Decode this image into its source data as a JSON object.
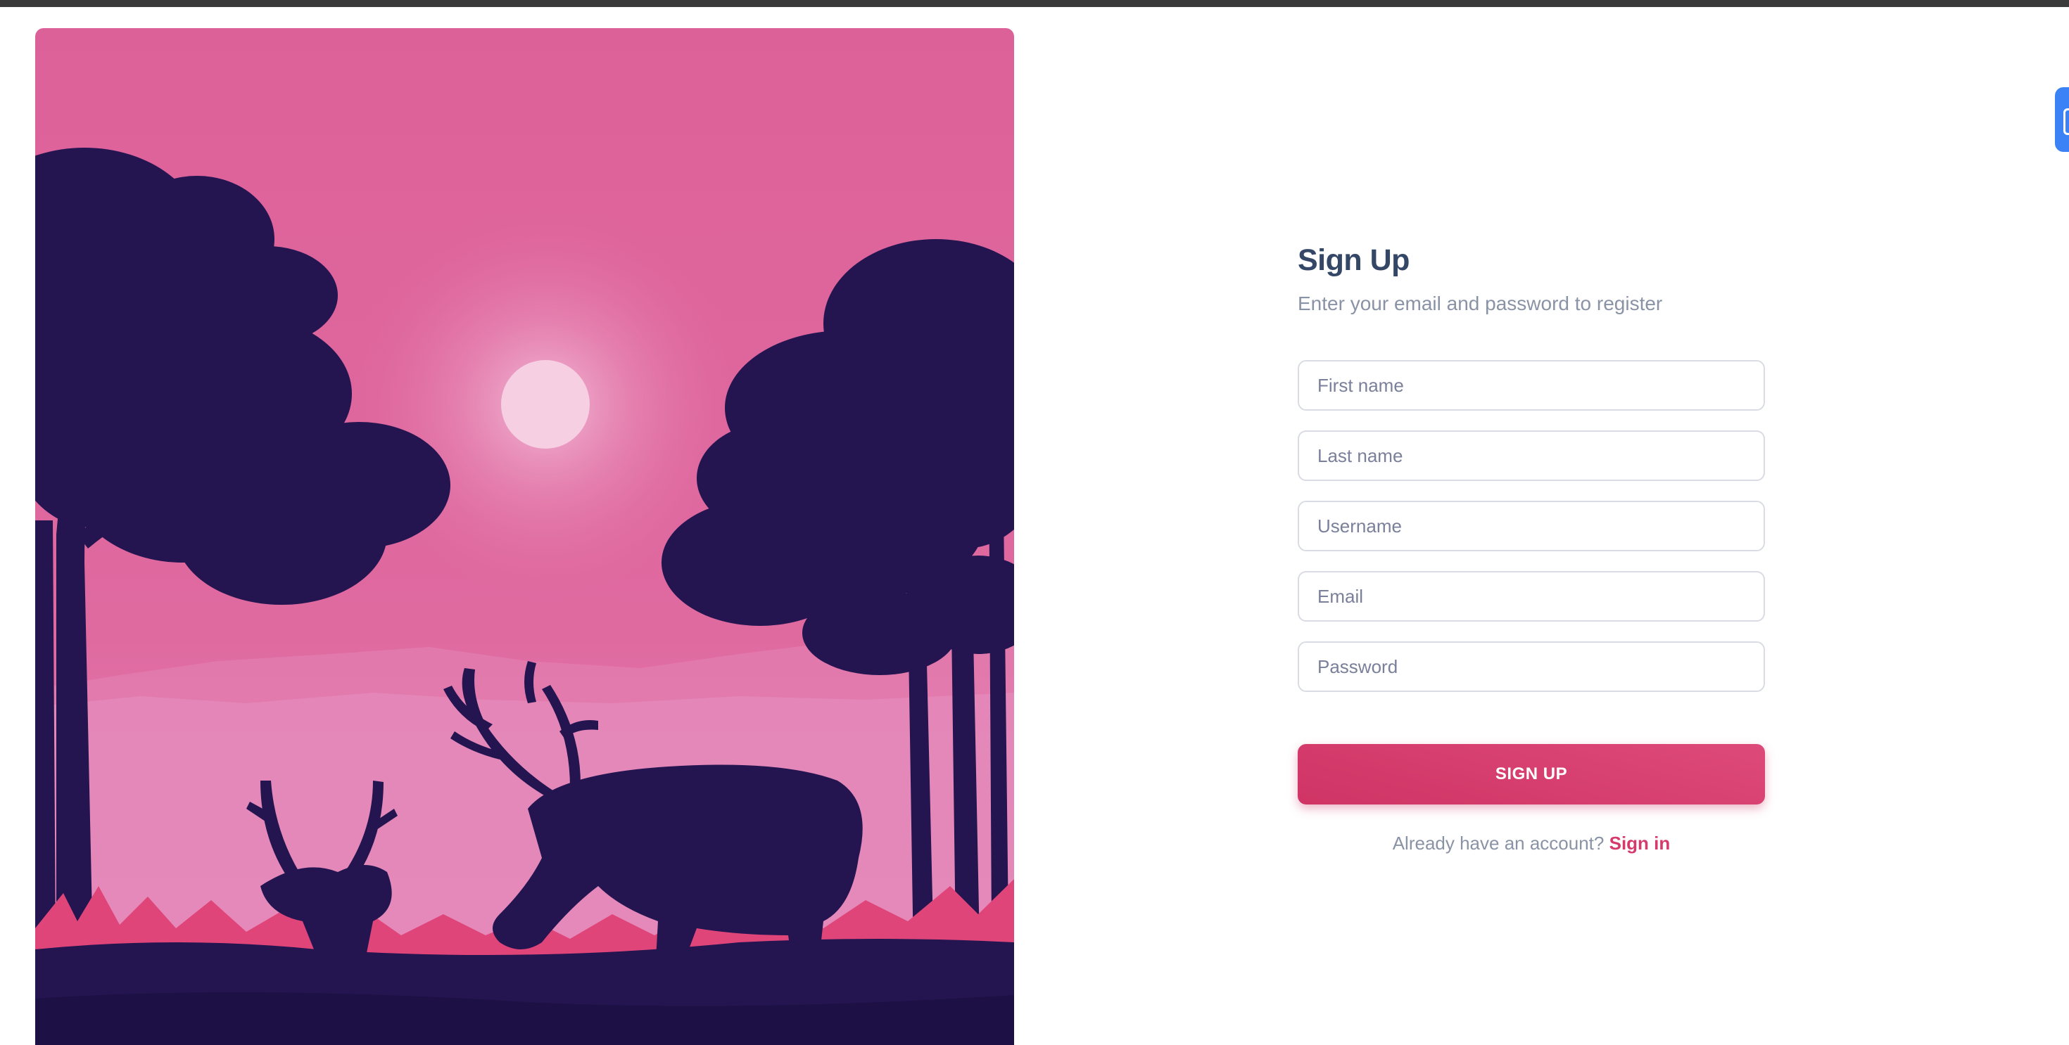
{
  "form": {
    "title": "Sign Up",
    "subtitle": "Enter your email and password to register",
    "fields": [
      {
        "placeholder": "First name",
        "value": ""
      },
      {
        "placeholder": "Last name",
        "value": ""
      },
      {
        "placeholder": "Username",
        "value": ""
      },
      {
        "placeholder": "Email",
        "value": ""
      },
      {
        "placeholder": "Password",
        "value": ""
      }
    ],
    "submit_label": "SIGN UP",
    "footer_text": "Already have an account?",
    "signin_label": "Sign in"
  },
  "colors": {
    "accent": "#d63a6c",
    "sky": "#dd6199",
    "silhouette": "#241550"
  }
}
